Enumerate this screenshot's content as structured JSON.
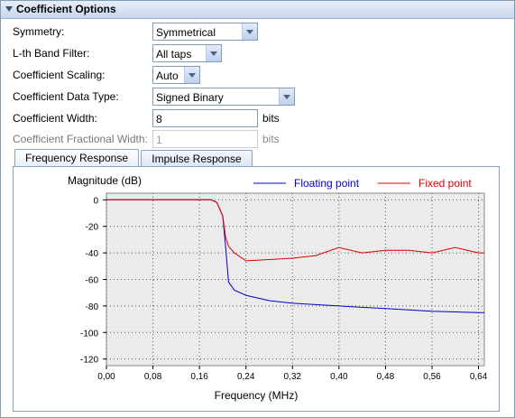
{
  "section_title": "Coefficient Options",
  "fields": {
    "symmetry": {
      "label": "Symmetry:",
      "value": "Symmetrical"
    },
    "band_filter": {
      "label": "L-th Band Filter:",
      "value": "All taps"
    },
    "scaling": {
      "label": "Coefficient Scaling:",
      "value": "Auto"
    },
    "data_type": {
      "label": "Coefficient Data Type:",
      "value": "Signed Binary"
    },
    "width": {
      "label": "Coefficient Width:",
      "value": "8",
      "unit": "bits"
    },
    "frac_width": {
      "label": "Coefficient Fractional Width:",
      "value": "1",
      "unit": "bits"
    }
  },
  "tabs": [
    {
      "label": "Frequency Response",
      "active": true
    },
    {
      "label": "Impulse Response",
      "active": false
    }
  ],
  "colors": {
    "floating": "#0000cc",
    "fixed": "#dd0000",
    "plot_bg": "#ebebeb"
  },
  "chart_data": {
    "type": "line",
    "ylabel": "Magnitude (dB)",
    "xlabel": "Frequency (MHz)",
    "xlim": [
      0,
      0.65
    ],
    "ylim": [
      -125,
      5
    ],
    "x_ticks": [
      0,
      0.08,
      0.16,
      0.24,
      0.32,
      0.4,
      0.48,
      0.56,
      0.64
    ],
    "x_tick_labels": [
      "0,00",
      "0,08",
      "0,16",
      "0,24",
      "0,32",
      "0,40",
      "0,48",
      "0,56",
      "0,64"
    ],
    "y_ticks": [
      0,
      -20,
      -40,
      -60,
      -80,
      -100,
      -120
    ],
    "y_tick_labels": [
      "0",
      "-20",
      "-40",
      "-60",
      "-80",
      "-100",
      "-120"
    ],
    "grid": true,
    "legend_position": "top",
    "series": [
      {
        "name": "Floating point",
        "color": "#0000cc",
        "x": [
          0,
          0.18,
          0.19,
          0.2,
          0.205,
          0.21,
          0.22,
          0.24,
          0.28,
          0.32,
          0.4,
          0.48,
          0.56,
          0.64,
          0.65
        ],
        "y": [
          0,
          0,
          -2,
          -12,
          -35,
          -62,
          -68,
          -72,
          -76,
          -78,
          -80,
          -82,
          -84,
          -85,
          -85
        ]
      },
      {
        "name": "Fixed point",
        "color": "#dd0000",
        "x": [
          0,
          0.18,
          0.19,
          0.2,
          0.205,
          0.21,
          0.22,
          0.24,
          0.28,
          0.32,
          0.36,
          0.4,
          0.44,
          0.48,
          0.52,
          0.56,
          0.6,
          0.64,
          0.65
        ],
        "y": [
          0,
          0,
          -2,
          -12,
          -28,
          -35,
          -40,
          -46,
          -45,
          -44,
          -42,
          -36,
          -40,
          -38,
          -38,
          -40,
          -36,
          -40,
          -40
        ]
      }
    ]
  }
}
